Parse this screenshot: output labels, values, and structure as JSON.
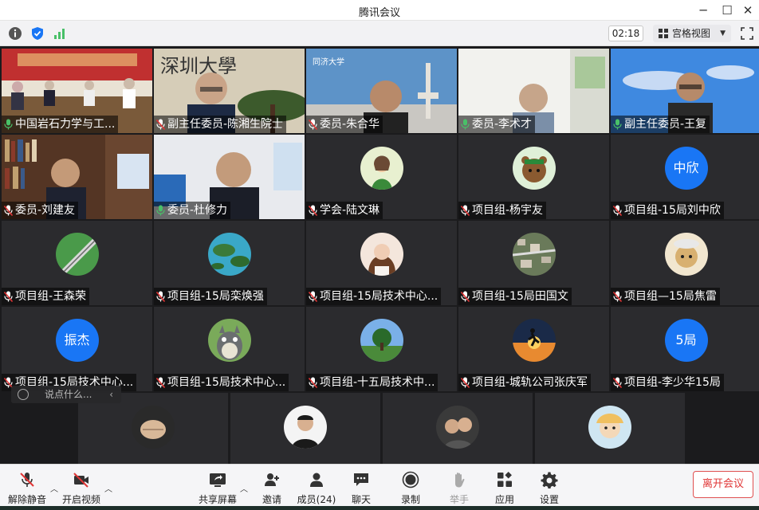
{
  "window": {
    "title": "腾讯会议",
    "minimize": "─",
    "maximize": "☐",
    "close": "✕"
  },
  "top_toolbar": {
    "timer": "02:18",
    "view_label": "宫格视图"
  },
  "tiles": [
    {
      "name": "中国岩石力学与工...",
      "mic": "on",
      "avatar": "video",
      "scene": "meeting-room"
    },
    {
      "name": "副主任委员-陈湘生院士",
      "mic": "off",
      "avatar": "video",
      "scene": "calligraphy"
    },
    {
      "name": "委员-朱合华",
      "mic": "off",
      "avatar": "video",
      "scene": "campus-sky"
    },
    {
      "name": "委员-李术才",
      "mic": "on",
      "avatar": "video",
      "scene": "bright-office",
      "active": true
    },
    {
      "name": "副主任委员-王复",
      "mic": "on",
      "avatar": "video",
      "scene": "blue-sky"
    },
    {
      "name": "委员-刘建友",
      "mic": "off",
      "avatar": "video",
      "scene": "bookshelf"
    },
    {
      "name": "委员-杜修力",
      "mic": "on",
      "avatar": "video",
      "scene": "white-room",
      "active": true
    },
    {
      "name": "学会-陆文琳",
      "mic": "off",
      "avatar": "cartoon-girl"
    },
    {
      "name": "项目组-杨宇友",
      "mic": "off",
      "avatar": "cartoon-bear"
    },
    {
      "name": "项目组-15局刘中欣",
      "mic": "off",
      "avatar_text": "中欣"
    },
    {
      "name": "项目组-王森荣",
      "mic": "off",
      "avatar": "railway"
    },
    {
      "name": "项目组-15局栾焕强",
      "mic": "off",
      "avatar": "island"
    },
    {
      "name": "项目组-15局技术中心...",
      "mic": "off",
      "avatar": "portrait-woman"
    },
    {
      "name": "项目组-15局田国文",
      "mic": "off",
      "avatar": "aerial-town"
    },
    {
      "name": "项目组—15局焦雷",
      "mic": "off",
      "avatar": "cartoon-dog"
    },
    {
      "name": "项目组-15局技术中心...",
      "mic": "off",
      "avatar_text": "振杰"
    },
    {
      "name": "项目组-15局技术中心...",
      "mic": "off",
      "avatar": "totoro"
    },
    {
      "name": "项目组-十五局技术中...",
      "mic": "off",
      "avatar": "park"
    },
    {
      "name": "项目组-城轨公司张庆军",
      "mic": "off",
      "avatar": "runner-sunset"
    },
    {
      "name": "项目组-李少华15局",
      "mic": "off",
      "avatar_text": "5局"
    }
  ],
  "bottom_row": [
    {
      "avatar": "hands"
    },
    {
      "avatar": "man-portrait"
    },
    {
      "avatar": "couple"
    },
    {
      "avatar": "cartoon-kid"
    }
  ],
  "chat": {
    "placeholder": "说点什么...",
    "collapse": "‹"
  },
  "bottom_toolbar": {
    "mute": "解除静音",
    "video": "开启视频",
    "share": "共享屏幕",
    "invite": "邀请",
    "members": "成员(24)",
    "chat": "聊天",
    "record": "录制",
    "raise_hand": "举手",
    "apps": "应用",
    "settings": "设置",
    "leave": "离开会议"
  },
  "colors": {
    "accent_blue": "#1976f5",
    "mic_green": "#49c068",
    "mic_muted_red": "#e03535",
    "leave_red": "#e03535"
  }
}
